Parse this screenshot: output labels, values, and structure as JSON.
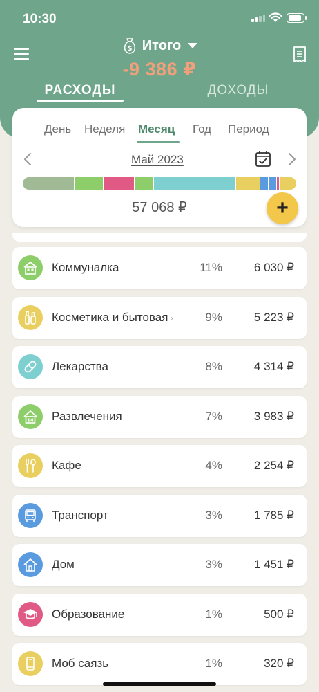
{
  "status_bar": {
    "time": "10:30"
  },
  "header": {
    "account_name": "Итого",
    "balance": "-9 386 ₽",
    "tabs": [
      {
        "label": "РАСХОДЫ",
        "active": true
      },
      {
        "label": "ДОХОДЫ",
        "active": false
      }
    ]
  },
  "period_selector": {
    "options": [
      "День",
      "Неделя",
      "Месяц",
      "Год",
      "Период"
    ],
    "active": "Месяц",
    "current_label": "Май 2023",
    "total": "57 068 ₽"
  },
  "distribution_bar": [
    {
      "color": "#9fba95",
      "share": 0.19
    },
    {
      "color": "#8dce6a",
      "share": 0.105
    },
    {
      "color": "#e15a85",
      "share": 0.115
    },
    {
      "color": "#8dce6a",
      "share": 0.07
    },
    {
      "color": "#7ecfd0",
      "share": 0.225
    },
    {
      "color": "#7ecfd0",
      "share": 0.075
    },
    {
      "color": "#e9cf5f",
      "share": 0.09
    },
    {
      "color": "#5a9be0",
      "share": 0.03
    },
    {
      "color": "#5a9be0",
      "share": 0.03
    },
    {
      "color": "#e15a85",
      "share": 0.01
    },
    {
      "color": "#e9cf5f",
      "share": 0.06
    }
  ],
  "add_button_label": "+",
  "categories": [
    {
      "name": "Коммуналка",
      "percent": "11%",
      "amount": "6 030 ₽",
      "icon": "house-icon",
      "color": "#8dce6a",
      "has_chevron": false
    },
    {
      "name": "Косметика и бытовая",
      "percent": "9%",
      "amount": "5 223 ₽",
      "icon": "cosmetics-icon",
      "color": "#e9cf5f",
      "has_chevron": true
    },
    {
      "name": "Лекарства",
      "percent": "8%",
      "amount": "4 314 ₽",
      "icon": "pill-icon",
      "color": "#7ecfd0",
      "has_chevron": false
    },
    {
      "name": "Развлечения",
      "percent": "7%",
      "amount": "3 983 ₽",
      "icon": "entertainment-icon",
      "color": "#8dce6a",
      "has_chevron": false
    },
    {
      "name": "Кафе",
      "percent": "4%",
      "amount": "2 254 ₽",
      "icon": "fork-spoon-icon",
      "color": "#e9cf5f",
      "has_chevron": false
    },
    {
      "name": "Транспорт",
      "percent": "3%",
      "amount": "1 785 ₽",
      "icon": "bus-icon",
      "color": "#5a9be0",
      "has_chevron": false
    },
    {
      "name": "Дом",
      "percent": "3%",
      "amount": "1 451 ₽",
      "icon": "home-icon",
      "color": "#5a9be0",
      "has_chevron": false
    },
    {
      "name": "Образование",
      "percent": "1%",
      "amount": "500 ₽",
      "icon": "graduation-cap-icon",
      "color": "#e15a85",
      "has_chevron": false
    },
    {
      "name": "Моб саязь",
      "percent": "1%",
      "amount": "320 ₽",
      "icon": "phone-icon",
      "color": "#e9cf5f",
      "has_chevron": false
    }
  ]
}
